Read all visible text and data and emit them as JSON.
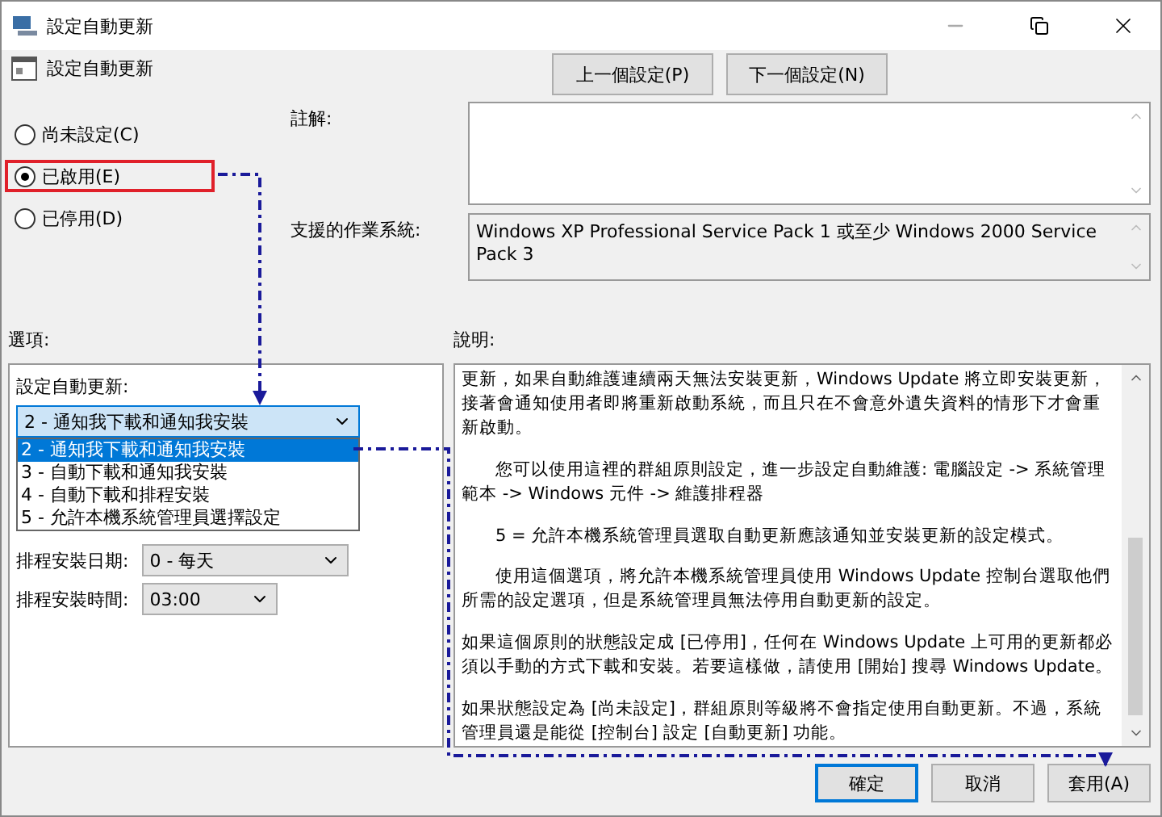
{
  "window": {
    "title": "設定自動更新"
  },
  "header": {
    "title": "設定自動更新",
    "buttons": [
      "上一個設定(P)",
      "下一個設定(N)"
    ]
  },
  "radios": [
    {
      "label": "尚未設定(C)",
      "selected": false,
      "highlighted": false
    },
    {
      "label": "已啟用(E)",
      "selected": true,
      "highlighted": true
    },
    {
      "label": "已停用(D)",
      "selected": false,
      "highlighted": false
    }
  ],
  "comment": {
    "label": "註解:"
  },
  "supported_os": {
    "label": "支援的作業系統:",
    "value": "Windows XP Professional Service Pack 1 或至少 Windows 2000 Service Pack 3"
  },
  "options": {
    "label": "選項:",
    "group_label": "設定自動更新:",
    "mode_select": {
      "value": "2 - 通知我下載和通知我安裝",
      "open": true
    },
    "mode_options": [
      {
        "label": "2 - 通知我下載和通知我安裝",
        "selected": true
      },
      {
        "label": "3 - 自動下載和通知我安裝",
        "selected": false
      },
      {
        "label": "4 - 自動下載和排程安裝",
        "selected": false
      },
      {
        "label": "5 - 允許本機系統管理員選擇設定",
        "selected": false
      }
    ],
    "day_row": {
      "label": "排程安裝日期:",
      "value": "0 - 每天"
    },
    "time_row": {
      "label": "排程安裝時間:",
      "value": "03:00"
    }
  },
  "description": {
    "label": "說明:",
    "paragraphs": [
      {
        "text": "更新，如果自動維護連續兩天無法安裝更新，Windows Update 將立即安裝更新，接著會通知使用者即將重新啟動系統，而且只在不會意外遺失資料的情形下才會重新啟動。",
        "indent": false
      },
      {
        "text": "您可以使用這裡的群組原則設定，進一步設定自動維護: 電腦設定 -> 系統管理範本 -> Windows 元件 -> 維護排程器",
        "indent": true
      },
      {
        "text": "5 = 允許本機系統管理員選取自動更新應該通知並安裝更新的設定模式。",
        "indent": true
      },
      {
        "text": "使用這個選項，將允許本機系統管理員使用 Windows Update 控制台選取他們所需的設定選項，但是系統管理員無法停用自動更新的設定。",
        "indent": true
      },
      {
        "text": "如果這個原則的狀態設定成 [已停用]，任何在 Windows Update 上可用的更新都必須以手動的方式下載和安裝。若要這樣做，請使用 [開始] 搜尋 Windows Update。",
        "indent": false
      },
      {
        "text": "如果狀態設定為 [尚未設定]，群組原則等級將不會指定使用自動更新。不過，系統管理員還是能從 [控制台] 設定 [自動更新] 功能。",
        "indent": false
      }
    ]
  },
  "footer_buttons": [
    {
      "label": "確定",
      "default": true
    },
    {
      "label": "取消",
      "default": false
    },
    {
      "label": "套用(A)",
      "default": false
    }
  ]
}
